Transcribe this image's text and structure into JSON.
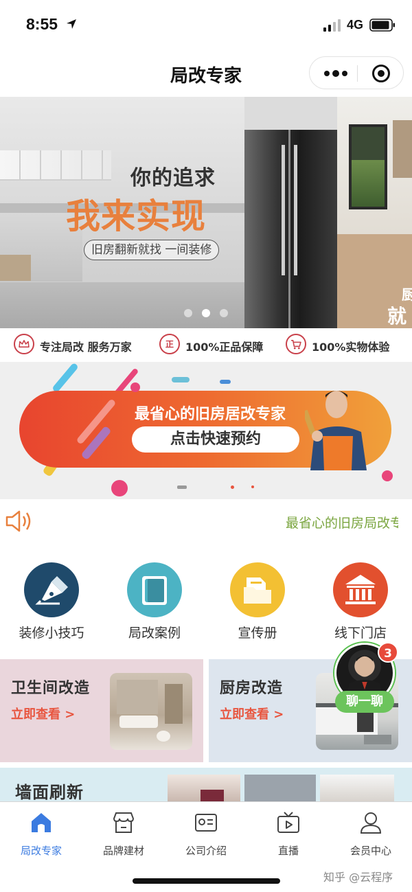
{
  "status_bar": {
    "time": "8:55",
    "network": "4G"
  },
  "nav": {
    "title": "局改专家"
  },
  "hero": {
    "title_line1": "你的追求",
    "title_line2": "我来实现",
    "subtitle": "旧房翻新就找 一间装修",
    "side_text_1": "厨",
    "side_text_2": "就"
  },
  "features": [
    {
      "icon": "crown-icon",
      "label": "专注局改 服务万家"
    },
    {
      "icon": "genuine-icon",
      "label": "100%正品保障"
    },
    {
      "icon": "cart-icon",
      "label": "100%实物体验"
    }
  ],
  "promo": {
    "title": "最省心的旧房居改专家",
    "button_label": "点击快速预约"
  },
  "notice": {
    "icon": "speaker-icon",
    "text": "最省心的旧房局改专家"
  },
  "quick_links": [
    {
      "icon": "pen-icon",
      "label": "装修小技巧",
      "color": "#1f4a6b"
    },
    {
      "icon": "notebook-icon",
      "label": "局改案例",
      "color": "#4cb3c4"
    },
    {
      "icon": "folder-icon",
      "label": "宣传册",
      "color": "#f3c033"
    },
    {
      "icon": "bank-icon",
      "label": "线下门店",
      "color": "#e2502e"
    }
  ],
  "cards": [
    {
      "title": "卫生间改造",
      "link": "立即查看 >",
      "bg": "#ead6dc"
    },
    {
      "title": "厨房改造",
      "link": "立即查看 >",
      "bg": "#dde5ee"
    }
  ],
  "chat": {
    "badge": "3",
    "button_label": "聊一聊"
  },
  "wall_card": {
    "title": "墙面刷新"
  },
  "tabbar": [
    {
      "icon": "home-icon",
      "label": "局改专家",
      "active": true
    },
    {
      "icon": "store-icon",
      "label": "品牌建材",
      "active": false
    },
    {
      "icon": "id-card-icon",
      "label": "公司介绍",
      "active": false
    },
    {
      "icon": "tv-icon",
      "label": "直播",
      "active": false
    },
    {
      "icon": "user-icon",
      "label": "会员中心",
      "active": false
    }
  ],
  "watermark": "知乎 @云程序",
  "colors": {
    "accent": "#3b7be0",
    "orange": "#e8803d",
    "promo_red": "#e8452f",
    "notice_green": "#7aa53f"
  }
}
